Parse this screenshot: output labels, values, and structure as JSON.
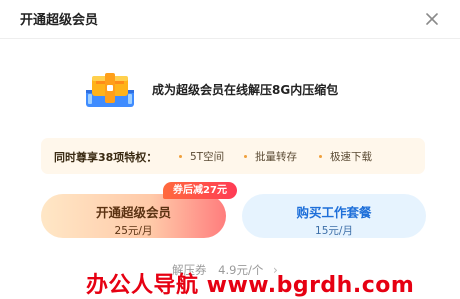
{
  "dialog": {
    "title": "开通超级会员",
    "close_icon": "close-icon"
  },
  "promo": {
    "icon": "treasure-box-icon",
    "text": "成为超级会员在线解压8G内压缩包"
  },
  "privileges": {
    "title": "同时尊享38项特权：",
    "items": [
      {
        "label": "5T空间"
      },
      {
        "label": "批量转存"
      },
      {
        "label": "极速下载"
      }
    ]
  },
  "plans": {
    "badge": "券后减27元",
    "super": {
      "name": "开通超级会员",
      "price": "25元/月"
    },
    "work": {
      "name": "购买工作套餐",
      "price": "15元/月"
    }
  },
  "unzip": {
    "label": "解压券",
    "price": "4.9元/个",
    "chevron_icon": "chevron-right-icon"
  },
  "watermark": {
    "text": "办公人导航   www.bgrdh.com"
  },
  "colors": {
    "badge": "#ff4a4a",
    "privileges_bg": "#fff7eb",
    "work_text": "#1e6fd9",
    "watermark": "#e60012"
  }
}
